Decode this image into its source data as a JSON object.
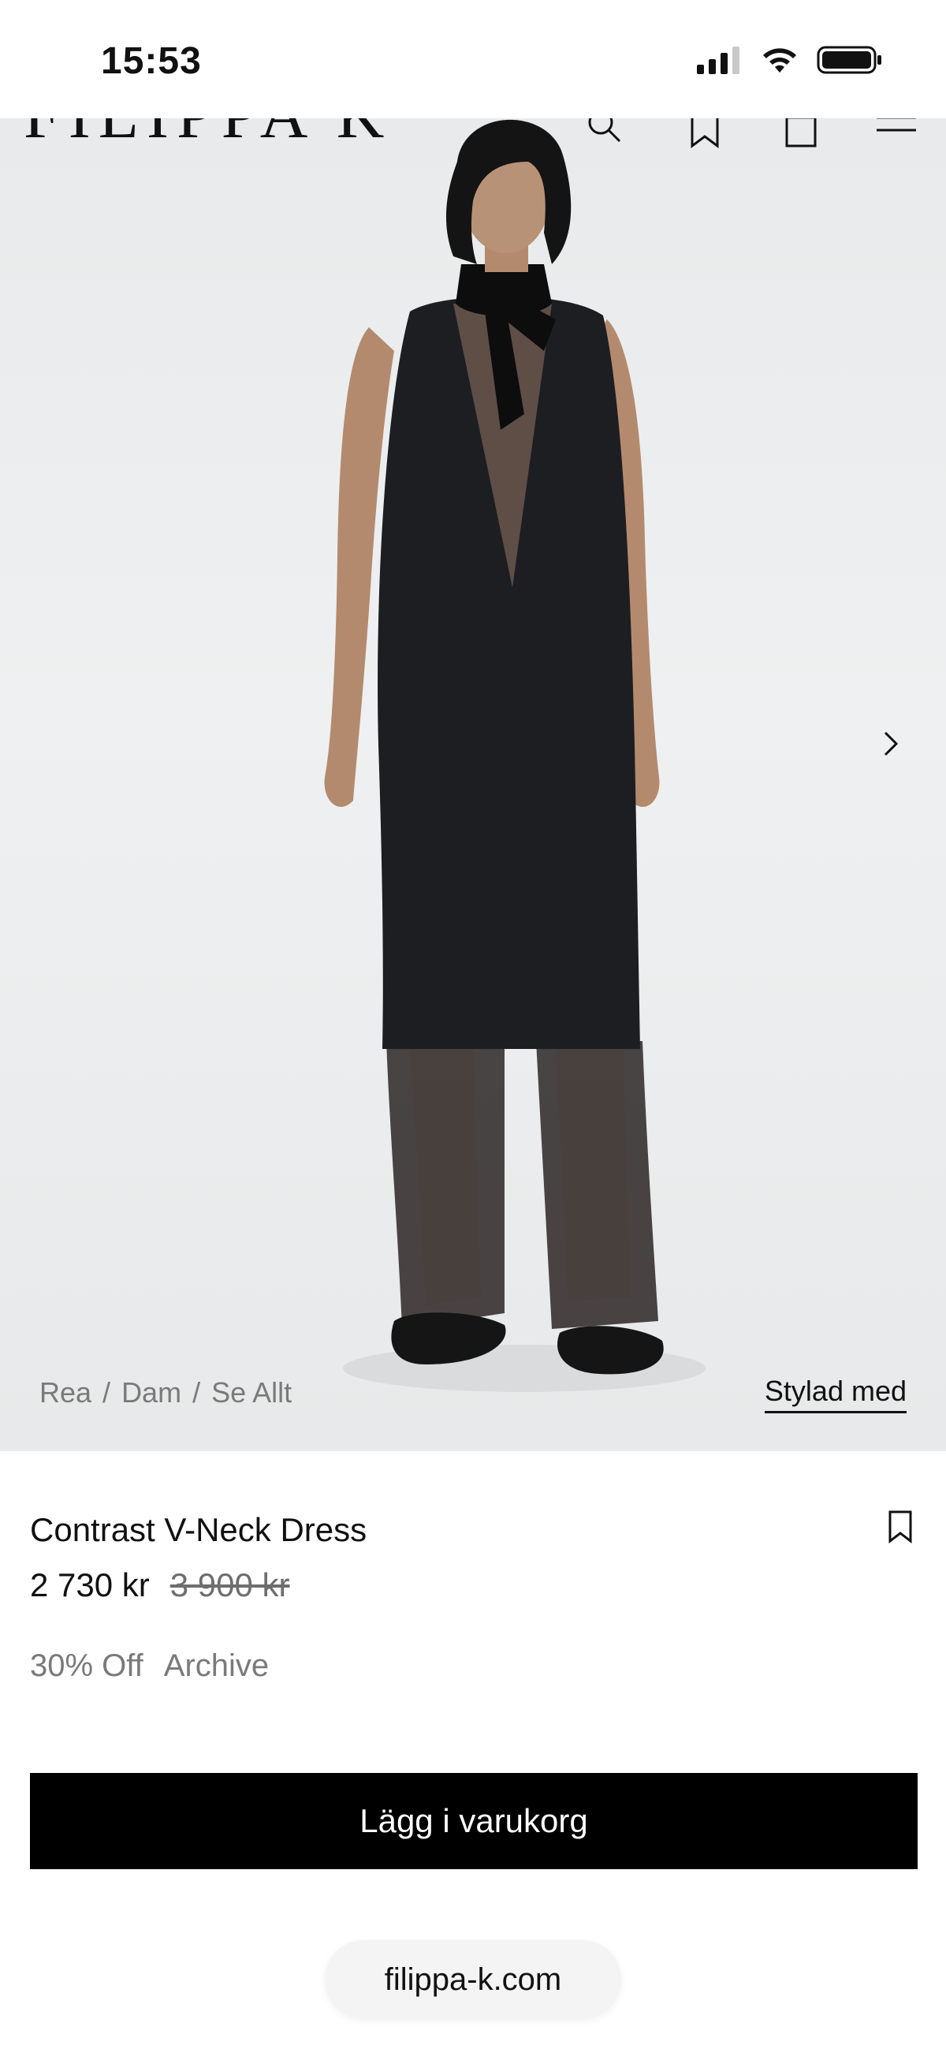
{
  "status_bar": {
    "time": "15:53",
    "icons": [
      "signal-icon",
      "wifi-icon",
      "battery-icon"
    ]
  },
  "header": {
    "logo": "FILIPPA K",
    "icons": [
      "search-icon",
      "bookmark-icon",
      "bag-icon",
      "menu-icon"
    ]
  },
  "gallery": {
    "next_icon": "chevron-right-icon"
  },
  "breadcrumb": {
    "items": [
      "Rea",
      "Dam",
      "Se Allt"
    ],
    "separator": "/"
  },
  "styled_with": "Stylad med",
  "product": {
    "name": "Contrast V-Neck Dress",
    "price": "2 730 kr",
    "original_price": "3 900 kr",
    "tags": [
      "30% Off",
      "Archive"
    ]
  },
  "cta": {
    "add_to_cart": "Lägg i varukorg"
  },
  "browser": {
    "url": "filippa-k.com"
  },
  "colors": {
    "accent": "#000000",
    "muted_text": "#7a7a7a",
    "image_bg": "#eceeef"
  }
}
